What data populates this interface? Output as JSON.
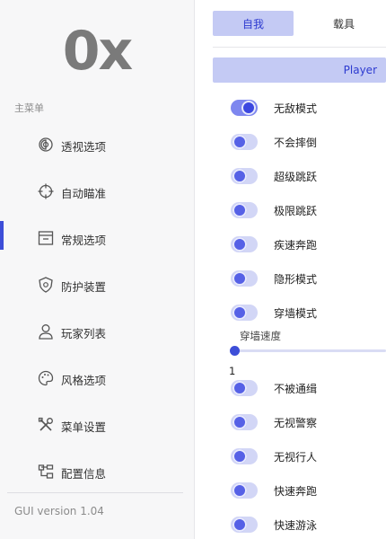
{
  "sidebar": {
    "logo": "0x",
    "menu_title": "主菜单",
    "items": [
      {
        "label": "透视选项",
        "icon": "eye-icon"
      },
      {
        "label": "自动瞄准",
        "icon": "crosshair-icon"
      },
      {
        "label": "常规选项",
        "icon": "window-icon"
      },
      {
        "label": "防护装置",
        "icon": "shield-icon"
      },
      {
        "label": "玩家列表",
        "icon": "user-icon"
      },
      {
        "label": "风格选项",
        "icon": "palette-icon"
      },
      {
        "label": "菜单设置",
        "icon": "tools-icon"
      },
      {
        "label": "配置信息",
        "icon": "structure-icon"
      }
    ],
    "active_index": 2,
    "version": "GUI version 1.04"
  },
  "tabs": [
    {
      "label": "自我",
      "active": true
    },
    {
      "label": "载具",
      "active": false
    }
  ],
  "section": {
    "title": "Player"
  },
  "toggles_top": [
    {
      "label": "无敌模式",
      "on": true
    },
    {
      "label": "不会摔倒",
      "on": false
    },
    {
      "label": "超级跳跃",
      "on": false
    },
    {
      "label": "极限跳跃",
      "on": false
    },
    {
      "label": "疾速奔跑",
      "on": false
    },
    {
      "label": "隐形模式",
      "on": false
    },
    {
      "label": "穿墙模式",
      "on": false
    }
  ],
  "slider": {
    "label": "穿墙速度",
    "value": "1",
    "fraction": 0.0
  },
  "toggles_bottom": [
    {
      "label": "不被通缉",
      "on": false
    },
    {
      "label": "无视警察",
      "on": false
    },
    {
      "label": "无视行人",
      "on": false
    },
    {
      "label": "快速奔跑",
      "on": false
    },
    {
      "label": "快速游泳",
      "on": false
    }
  ],
  "colors": {
    "accent": "#3d4ed8",
    "accent_light": "#c4caf4",
    "sidebar_bg": "#f7f7f8"
  }
}
